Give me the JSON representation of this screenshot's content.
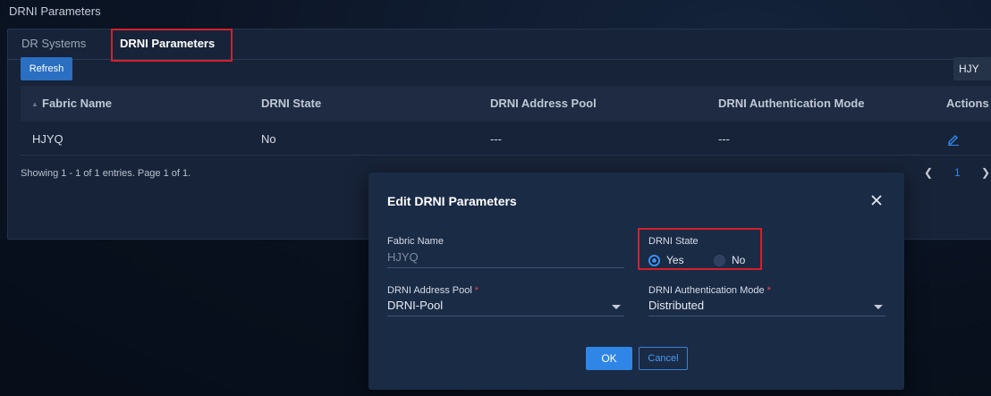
{
  "page": {
    "title": "DRNI Parameters"
  },
  "tabs": [
    {
      "label": "DR Systems"
    },
    {
      "label": "DRNI Parameters"
    }
  ],
  "toolbar": {
    "refresh_label": "Refresh",
    "right_button_label": "HJY"
  },
  "table": {
    "columns": [
      "Fabric Name",
      "DRNI State",
      "DRNI Address Pool",
      "DRNI Authentication Mode",
      "Actions"
    ],
    "rows": [
      {
        "fabric_name": "HJYQ",
        "drni_state": "No",
        "address_pool": "---",
        "auth_mode": "---",
        "action_icon": "edit-icon"
      }
    ]
  },
  "footer": {
    "summary": "Showing 1 - 1 of 1 entries. Page 1 of 1.",
    "current_page": "1",
    "prev_icon": "chevron-left-icon",
    "next_icon": "chevron-right-icon"
  },
  "modal": {
    "title": "Edit DRNI Parameters",
    "close_icon": "close-icon",
    "fabric_name_label": "Fabric Name",
    "fabric_name_value": "HJYQ",
    "drni_state_label": "DRNI State",
    "drni_state_options": [
      "Yes",
      "No"
    ],
    "drni_state_selected": "Yes",
    "address_pool_label": "DRNI Address Pool",
    "address_pool_value": "DRNI-Pool",
    "auth_mode_label": "DRNI Authentication Mode",
    "auth_mode_value": "Distributed",
    "required_mark": "*",
    "ok_label": "OK",
    "cancel_label": "Cancel"
  },
  "colors": {
    "accent": "#2f86e6",
    "highlight_box": "#d3202a",
    "required": "#e5484d",
    "panel_bg": "#172338",
    "modal_bg": "#1a2b46"
  }
}
